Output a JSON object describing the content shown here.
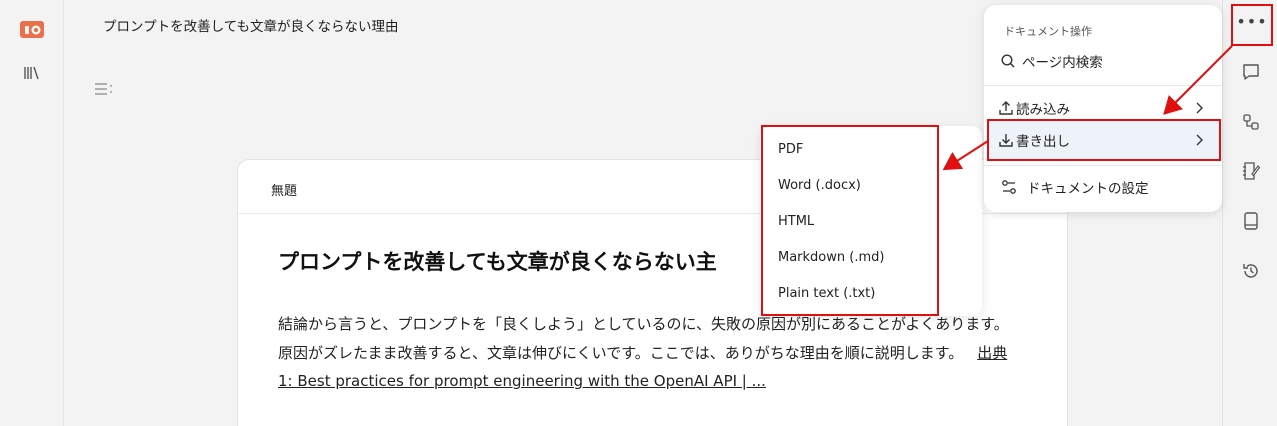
{
  "header": {
    "title": "プロンプトを改善しても文章が良くならない理由"
  },
  "document": {
    "card_title": "無題",
    "heading": "プロンプトを改善しても文章が良くならない主",
    "body_text": "結論から言うと、プロンプトを「良くしよう」としているのに、失敗の原因が別にあることがよくあります。原因がズレたまま改善すると、文章は伸びにくいです。ここでは、ありがちな理由を順に説明します。",
    "source_link": "出典1: Best practices for prompt engineering with the OpenAI API | ..."
  },
  "doc_menu": {
    "heading": "ドキュメント操作",
    "search": "ページ内検索",
    "import": "読み込み",
    "export": "書き出し",
    "settings": "ドキュメントの設定"
  },
  "export_menu": {
    "items": [
      "PDF",
      "Word (.docx)",
      "HTML",
      "Markdown (.md)",
      "Plain text (.txt)"
    ]
  },
  "colors": {
    "annotation_red": "#e01010",
    "logo_orange": "#e8714a"
  }
}
